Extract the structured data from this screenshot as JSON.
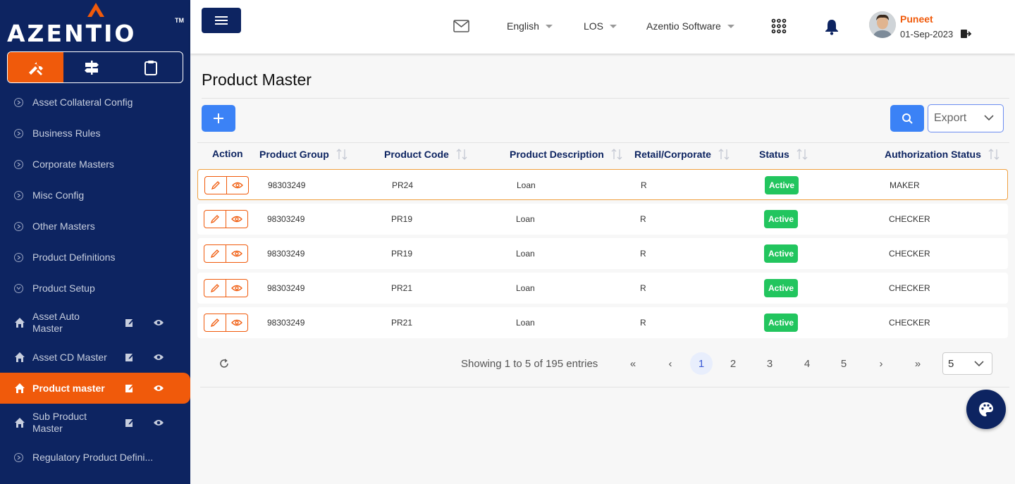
{
  "brand": {
    "name": "AZENTIO",
    "tm": "TM"
  },
  "mode_tabs": [
    {
      "icon": "tools-icon"
    },
    {
      "icon": "signpost-icon"
    },
    {
      "icon": "clipboard-icon"
    }
  ],
  "sidebar": {
    "menu": [
      {
        "label": "Asset Collateral Config"
      },
      {
        "label": "Business Rules"
      },
      {
        "label": "Corporate Masters"
      },
      {
        "label": "Misc Config"
      },
      {
        "label": "Other Masters"
      },
      {
        "label": "Product Definitions"
      },
      {
        "label": "Product Setup"
      }
    ],
    "sub_items": [
      {
        "label": "Asset Auto Master"
      },
      {
        "label": "Asset CD Master"
      },
      {
        "label": "Product master"
      },
      {
        "label": "Sub Product Master"
      }
    ],
    "bottom_item": {
      "label": "Regulatory Product Defini..."
    }
  },
  "topbar": {
    "language": "English",
    "module": "LOS",
    "org": "Azentio Software",
    "user_name": "Puneet",
    "user_date": "01-Sep-2023"
  },
  "page": {
    "title": "Product Master",
    "export_label": "Export"
  },
  "table": {
    "headers": [
      "Action",
      "Product Group",
      "Product Code",
      "Product Description",
      "Retail/Corporate",
      "Status",
      "Authorization Status"
    ],
    "rows": [
      {
        "group": "98303249",
        "code": "PR24",
        "desc": "Loan",
        "rc": "R",
        "status": "Active",
        "auth": "MAKER"
      },
      {
        "group": "98303249",
        "code": "PR19",
        "desc": "Loan",
        "rc": "R",
        "status": "Active",
        "auth": "CHECKER"
      },
      {
        "group": "98303249",
        "code": "PR19",
        "desc": "Loan",
        "rc": "R",
        "status": "Active",
        "auth": "CHECKER"
      },
      {
        "group": "98303249",
        "code": "PR21",
        "desc": "Loan",
        "rc": "R",
        "status": "Active",
        "auth": "CHECKER"
      },
      {
        "group": "98303249",
        "code": "PR21",
        "desc": "Loan",
        "rc": "R",
        "status": "Active",
        "auth": "CHECKER"
      }
    ]
  },
  "pagination": {
    "summary": "Showing 1 to 5 of 195 entries",
    "first": "«",
    "prev": "‹",
    "next": "›",
    "last": "»",
    "pages": [
      "1",
      "2",
      "3",
      "4",
      "5"
    ],
    "page_size": "5"
  },
  "colors": {
    "navy": "#0d2461",
    "accent": "#f05a0b",
    "primary": "#3b82f6",
    "success": "#22c55e"
  }
}
